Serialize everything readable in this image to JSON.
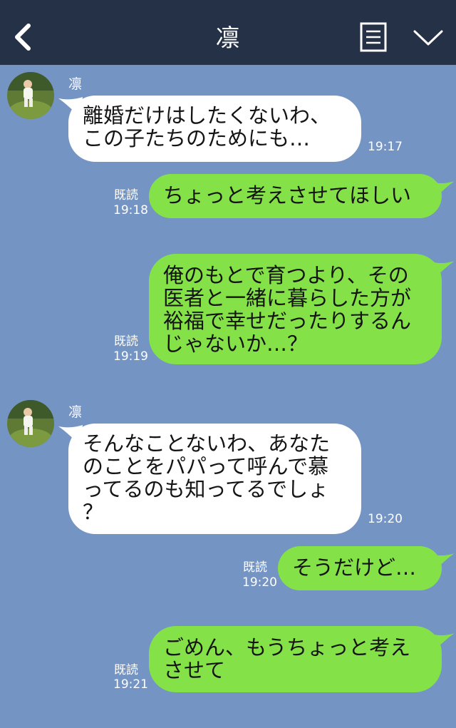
{
  "header": {
    "title": "凛",
    "back_icon": "chevron-left-icon",
    "notes_icon": "notes-icon",
    "menu_icon": "chevron-down-icon"
  },
  "colors": {
    "header_bg": "#253147",
    "chat_bg": "#7494c4",
    "incoming_bubble": "#ffffff",
    "outgoing_bubble": "#84e147"
  },
  "messages": [
    {
      "side": "in",
      "sender": "凛",
      "text": "離婚だけはしたくないわ、\nこの子たちのためにも…",
      "time": "19:17"
    },
    {
      "side": "out",
      "read": "既読",
      "text": "ちょっと考えさせてほしい",
      "time": "19:18"
    },
    {
      "side": "out",
      "read": "既読",
      "text": "俺のもとで育つより、その\n医者と一緒に暮らした方が\n裕福で幸せだったりするん\nじゃないか…？",
      "time": "19:19"
    },
    {
      "side": "in",
      "sender": "凛",
      "text": "そんなことないわ、あなた\nのことをパパって呼んで慕\nってるのも知ってるでしょ\n？",
      "time": "19:20"
    },
    {
      "side": "out",
      "read": "既読",
      "text": "そうだけど…",
      "time": "19:20"
    },
    {
      "side": "out",
      "read": "既読",
      "text": "ごめん、もうちょっと考え\nさせて",
      "time": "19:21"
    }
  ]
}
